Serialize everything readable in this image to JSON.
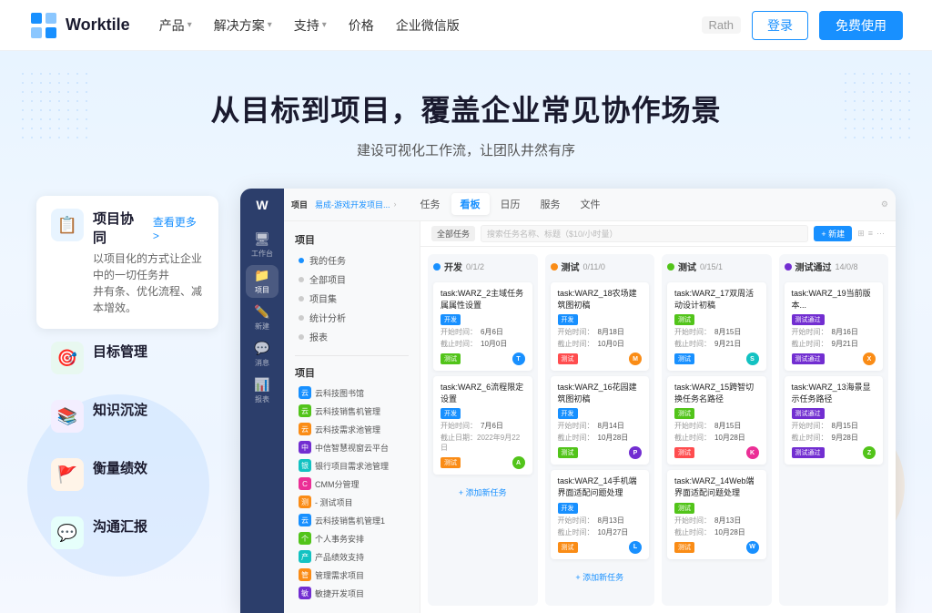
{
  "nav": {
    "logo_text": "Worktile",
    "links": [
      {
        "label": "产品",
        "has_arrow": true
      },
      {
        "label": "解决方案",
        "has_arrow": true
      },
      {
        "label": "支持",
        "has_arrow": true
      },
      {
        "label": "价格",
        "has_arrow": false
      },
      {
        "label": "企业微信版",
        "has_arrow": false
      }
    ],
    "email_placeholder": "Rath",
    "btn_login": "登录",
    "btn_free": "免费使用"
  },
  "hero": {
    "title": "从目标到项目，覆盖企业常见协作场景",
    "subtitle": "建设可视化工作流，让团队井然有序"
  },
  "features": [
    {
      "id": "project",
      "icon": "📋",
      "icon_class": "blue",
      "name": "项目协同",
      "link": "查看更多 >",
      "desc": "以项目化的方式让企业中的一切任务井\n井有条、优化流程、减本增效。",
      "active": true
    },
    {
      "id": "goal",
      "icon": "🎯",
      "icon_class": "green",
      "name": "目标管理",
      "link": "",
      "desc": "",
      "active": false
    },
    {
      "id": "knowledge",
      "icon": "📚",
      "icon_class": "purple",
      "name": "知识沉淀",
      "link": "",
      "desc": "",
      "active": false
    },
    {
      "id": "performance",
      "icon": "🚩",
      "icon_class": "orange",
      "name": "衡量绩效",
      "link": "",
      "desc": "",
      "active": false
    },
    {
      "id": "report",
      "icon": "💬",
      "icon_class": "teal",
      "name": "沟通汇报",
      "link": "",
      "desc": "",
      "active": false
    }
  ],
  "app": {
    "project_title": "易成-游戏开发项目...",
    "tabs": [
      "任务",
      "看板",
      "日历",
      "服务",
      "文件"
    ],
    "active_tab": "看板",
    "filter_tag": "全部任务",
    "search_placeholder": "搜索任务名称、标题（$10/小时量）",
    "add_btn": "+ 新建",
    "sidebar_items": [
      {
        "icon": "🖥",
        "label": "工作台"
      },
      {
        "icon": "📁",
        "label": "项目"
      },
      {
        "icon": "📝",
        "label": "新建"
      },
      {
        "icon": "💬",
        "label": "消息"
      },
      {
        "icon": "📊",
        "label": "报表"
      }
    ],
    "left_panel": {
      "header": "项目",
      "menu_items": [
        {
          "label": "我的任务",
          "dot": "blue"
        },
        {
          "label": "全部项目",
          "dot": ""
        },
        {
          "label": "项目集",
          "dot": ""
        },
        {
          "label": "统计分析",
          "dot": ""
        },
        {
          "label": "报表",
          "dot": ""
        }
      ],
      "projects_header": "项目",
      "projects": [
        {
          "label": "云科技图书馆",
          "color": "#1890ff"
        },
        {
          "label": "云科技销售机管理",
          "color": "#52c41a"
        },
        {
          "label": "云科技需求池管理",
          "color": "#fa8c16"
        },
        {
          "label": "中信智慧视窗云平台",
          "color": "#722ed1"
        },
        {
          "label": "银行项目需求池管理",
          "color": "#13c2c2"
        },
        {
          "label": "CMM分管理",
          "color": "#eb2f96"
        },
        {
          "label": "- 测试项目",
          "color": "#fa8c16"
        },
        {
          "label": "云科技销售机管理1",
          "color": "#1890ff"
        },
        {
          "label": "个人事务安排",
          "color": "#52c41a"
        },
        {
          "label": "产品绩效支持",
          "color": "#13c2c2"
        },
        {
          "label": "管理需求项目",
          "color": "#fa8c16"
        },
        {
          "label": "敏捷开发项目",
          "color": "#722ed1"
        }
      ]
    },
    "columns": [
      {
        "title": "开发",
        "count": "0/1/2",
        "dot": "blue",
        "cards": [
          {
            "title": "task:WARZ_2主域任务属属性设置",
            "tag1": "开发",
            "tag1_color": "blue",
            "date1_label": "开始时间：",
            "date1": "6月6日",
            "date2_label": "截止时间：",
            "date2": "10月0日",
            "bottom_tag": "测试",
            "bottom_tag_color": "green",
            "avatar_color": "#1890ff",
            "avatar_text": "T"
          },
          {
            "title": "task:WARZ_6流程限定设置",
            "tag1": "开发",
            "tag1_color": "blue",
            "date1_label": "开始时间：",
            "date1": "7月6日",
            "date2_label": "截止日期：2022年9月22日",
            "date2": "",
            "bottom_tag": "测试",
            "bottom_tag_color": "orange",
            "avatar_color": "#52c41a",
            "avatar_text": "A"
          }
        ],
        "add_task": "+ 添加新任务"
      },
      {
        "title": "测试",
        "count": "0/11/0",
        "dot": "orange",
        "cards": [
          {
            "title": "task:WARZ_18农场建筑图初稿",
            "tag1": "开发",
            "tag1_color": "blue",
            "date1_label": "开始时间：",
            "date1": "8月18日",
            "date2_label": "截止时间：",
            "date2": "10月0日",
            "bottom_tag": "测试",
            "bottom_tag_color": "red",
            "avatar_color": "#fa8c16",
            "avatar_text": "M"
          },
          {
            "title": "task:WARZ_16花园建筑图初稿",
            "tag1": "开发",
            "tag1_color": "blue",
            "date1_label": "开始时间：",
            "date1": "8月14日",
            "date2_label": "截止时间：",
            "date2": "10月28日",
            "bottom_tag": "测试",
            "bottom_tag_color": "green",
            "avatar_color": "#722ed1",
            "avatar_text": "P"
          },
          {
            "title": "task:WARZ_14手机端界面适配问题处理",
            "tag1": "开发",
            "tag1_color": "blue",
            "date1_label": "开始时间：",
            "date1": "8月13日",
            "date2_label": "截止时间：",
            "date2": "10月27日",
            "bottom_tag": "测试",
            "bottom_tag_color": "orange",
            "avatar_color": "#1890ff",
            "avatar_text": "L"
          }
        ],
        "add_task": "+ 添加新任务"
      },
      {
        "title": "测试",
        "count": "0/15/1",
        "dot": "green",
        "cards": [
          {
            "title": "task:WARZ_17双周活动设计初稿",
            "tag1": "测试",
            "tag1_color": "green",
            "date1_label": "开始时间：",
            "date1": "8月15日",
            "date2_label": "截止时间：",
            "date2": "9月21日",
            "bottom_tag": "测试",
            "bottom_tag_color": "blue",
            "avatar_color": "#13c2c2",
            "avatar_text": "S"
          },
          {
            "title": "task:WARZ_15跨智切换任务名路径",
            "tag1": "测试",
            "tag1_color": "green",
            "date1_label": "开始时间：",
            "date1": "8月15日",
            "date2_label": "截止时间：",
            "date2": "10月28日",
            "bottom_tag": "测试",
            "bottom_tag_color": "red",
            "avatar_color": "#eb2f96",
            "avatar_text": "K"
          },
          {
            "title": "task:WARZ_14Web端界面适配问题处理",
            "tag1": "测试",
            "tag1_color": "green",
            "date1_label": "开始时间：",
            "date1": "8月13日",
            "date2_label": "截止时间：",
            "date2": "10月28日",
            "bottom_tag": "测试",
            "bottom_tag_color": "orange",
            "avatar_color": "#1890ff",
            "avatar_text": "W"
          }
        ],
        "add_task": "+ 添加新任务"
      },
      {
        "title": "测试通过",
        "count": "14/0/8",
        "dot": "purple",
        "cards": [
          {
            "title": "task:WARZ_19当前版本...",
            "tag1": "测试通过",
            "tag1_color": "purple",
            "date1_label": "开始时间：",
            "date1": "8月16日",
            "date2_label": "截止时间：",
            "date2": "9月21日",
            "bottom_tag": "测试通过",
            "bottom_tag_color": "purple",
            "avatar_color": "#fa8c16",
            "avatar_text": "X"
          },
          {
            "title": "task:WARZ_13海景显示任务路径",
            "tag1": "测试通过",
            "tag1_color": "purple",
            "date1_label": "开始时间：",
            "date1": "8月15日",
            "date2_label": "截止时间：",
            "date2": "9月28日",
            "bottom_tag": "测试通过",
            "bottom_tag_color": "purple",
            "avatar_color": "#52c41a",
            "avatar_text": "Z"
          }
        ],
        "add_task": ""
      }
    ]
  },
  "colors": {
    "accent_blue": "#1890ff",
    "sidebar_bg": "#2c3e6b"
  }
}
